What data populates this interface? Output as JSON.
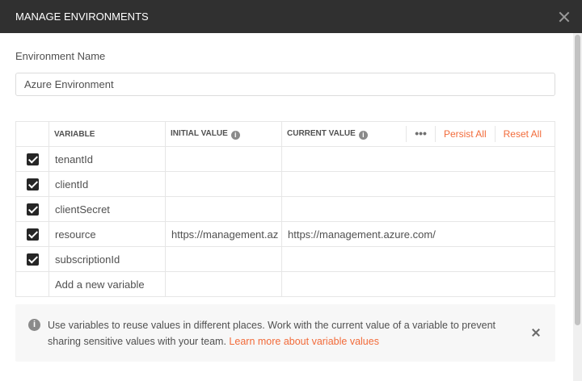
{
  "dialog": {
    "title": "MANAGE ENVIRONMENTS"
  },
  "environment": {
    "label": "Environment Name",
    "value": "Azure Environment"
  },
  "table": {
    "headers": {
      "variable": "VARIABLE",
      "initial_value": "INITIAL VALUE",
      "current_value": "CURRENT VALUE",
      "more": "•••",
      "persist_all": "Persist All",
      "reset_all": "Reset All"
    },
    "rows": [
      {
        "checked": true,
        "variable": "tenantId",
        "initial": "",
        "current": ""
      },
      {
        "checked": true,
        "variable": "clientId",
        "initial": "",
        "current": ""
      },
      {
        "checked": true,
        "variable": "clientSecret",
        "initial": "",
        "current": ""
      },
      {
        "checked": true,
        "variable": "resource",
        "initial": "https://management.az",
        "current": "https://management.azure.com/"
      },
      {
        "checked": true,
        "variable": "subscriptionId",
        "initial": "",
        "current": ""
      }
    ],
    "add_placeholder": "Add a new variable"
  },
  "banner": {
    "text": "Use variables to reuse values in different places. Work with the current value of a variable to prevent sharing sensitive values with your team.",
    "link": "Learn more about variable values"
  },
  "icons": {
    "close": "close-icon",
    "info": "info-icon",
    "check": "checkbox-checked-icon"
  },
  "colors": {
    "titlebar": "#303030",
    "accent": "#f26b3a",
    "banner_bg": "#f7f7f7"
  }
}
